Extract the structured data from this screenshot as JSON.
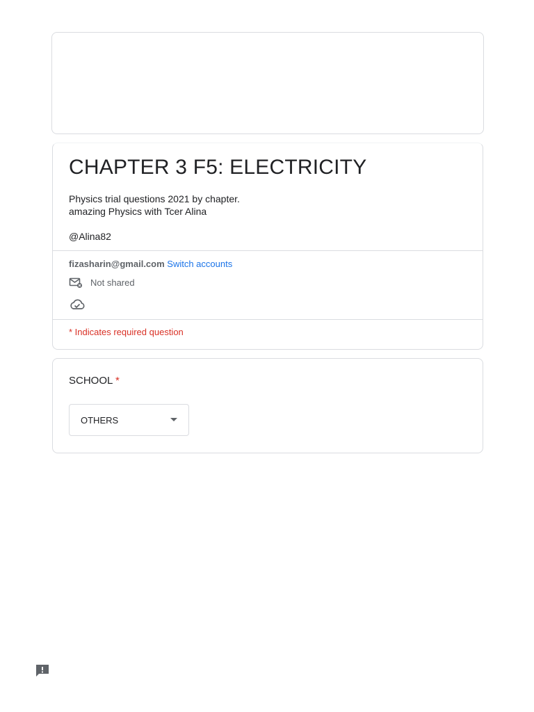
{
  "form": {
    "title": "CHAPTER 3 F5: ELECTRICITY",
    "description_line1": "Physics trial questions 2021 by chapter.",
    "description_line2": "amazing Physics with Tcer Alina",
    "handle": "@Alina82"
  },
  "account": {
    "email": "fizasharin@gmail.com",
    "switch_label": "Switch accounts",
    "shared_status": "Not shared"
  },
  "required_note": "* Indicates required question",
  "question": {
    "label": "SCHOOL",
    "required_mark": "*",
    "selected_value": "OTHERS"
  },
  "icons": [
    "mail-not-shared-icon",
    "cloud-check-icon",
    "feedback-icon",
    "dropdown-caret-icon"
  ],
  "colors": {
    "link": "#1a73e8",
    "required": "#d93025",
    "border": "#dadce0"
  }
}
